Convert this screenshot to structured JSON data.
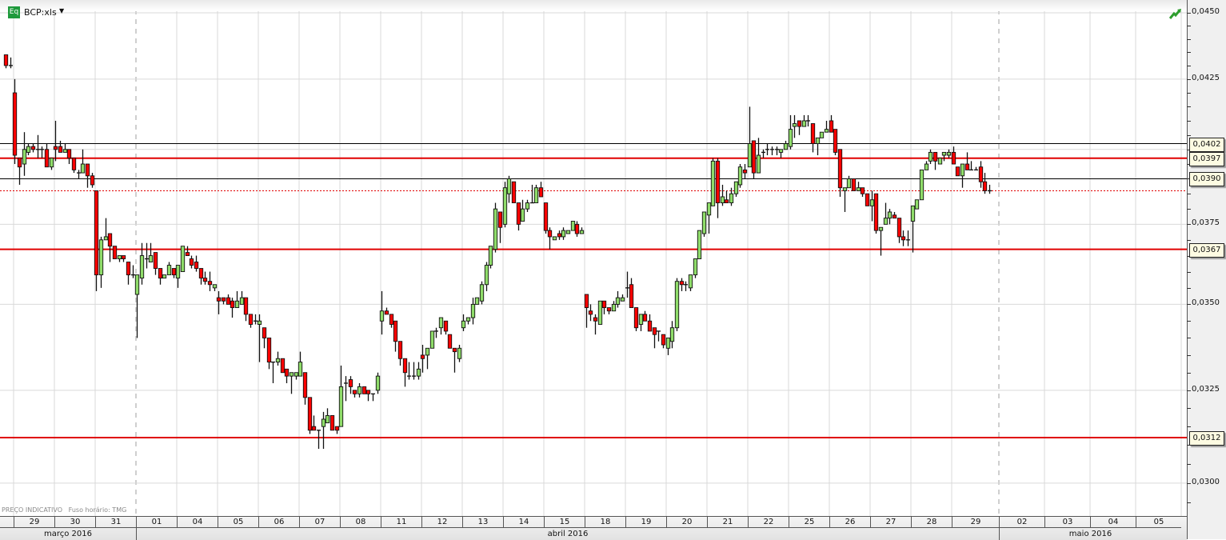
{
  "header": {
    "icon_label": "Eq",
    "symbol": "BCP:xls",
    "caret": "▼",
    "trend_icon": "trend-up-icon"
  },
  "footer": {
    "note": "PREÇO INDICATIVO   Fuso horário: TMG"
  },
  "colors": {
    "up": "#8fdc6a",
    "down": "#ff0000",
    "hline_red": "#e00000",
    "hline_black": "#000000",
    "grid": "#d9d9d9"
  },
  "chart_data": {
    "type": "candlestick",
    "title": "BCP:xls",
    "scale": "log",
    "ylim": [
      0.029,
      0.045
    ],
    "y_ticks": [
      {
        "value": 0.045,
        "label": "0,0450"
      },
      {
        "value": 0.0425,
        "label": "0,0425"
      },
      {
        "value": 0.0375,
        "label": "0,0375"
      },
      {
        "value": 0.035,
        "label": "0,0350"
      },
      {
        "value": 0.0325,
        "label": "0,0325"
      },
      {
        "value": 0.03,
        "label": "0,0300"
      }
    ],
    "grid_values": [
      0.045,
      0.0425,
      0.04,
      0.0375,
      0.035,
      0.0325,
      0.03
    ],
    "price_lines": [
      {
        "value": 0.0402,
        "label": "0,0402",
        "color": "black",
        "style": "solid"
      },
      {
        "value": 0.0397,
        "label": "0,0397",
        "color": "red",
        "style": "solid"
      },
      {
        "value": 0.039,
        "label": "0,0390",
        "color": "black",
        "style": "solid"
      },
      {
        "value": 0.0386,
        "label": "",
        "color": "red",
        "style": "dotted"
      },
      {
        "value": 0.0367,
        "label": "0,0367",
        "color": "red",
        "style": "solid"
      },
      {
        "value": 0.0312,
        "label": "0,0312",
        "color": "red",
        "style": "solid"
      }
    ],
    "days": [
      "29",
      "30",
      "31",
      "01",
      "04",
      "05",
      "06",
      "07",
      "08",
      "11",
      "12",
      "13",
      "14",
      "15",
      "18",
      "19",
      "20",
      "21",
      "22",
      "25",
      "26",
      "27",
      "28",
      "29",
      "02",
      "03",
      "04",
      "05"
    ],
    "months": [
      {
        "label": "março 2016",
        "first_day": 0,
        "last_day": 2
      },
      {
        "label": "abril 2016",
        "first_day": 3,
        "last_day": 23
      },
      {
        "label": "maio 2016",
        "first_day": 24,
        "last_day": 27
      }
    ],
    "ohlc_format": [
      "open",
      "high",
      "low",
      "close"
    ],
    "candles": [
      [
        0.0434,
        0.0434,
        0.0429,
        0.043
      ],
      [
        0.043,
        0.0433,
        0.0429,
        0.043
      ],
      [
        0.042,
        0.0425,
        0.0395,
        0.0398
      ],
      [
        0.0397,
        0.0397,
        0.0388,
        0.0394
      ],
      [
        0.0395,
        0.0406,
        0.0391,
        0.04
      ],
      [
        0.0399,
        0.0402,
        0.0398,
        0.0401
      ],
      [
        0.0401,
        0.0402,
        0.0399,
        0.04
      ],
      [
        0.04,
        0.0405,
        0.0397,
        0.04
      ],
      [
        0.04,
        0.0401,
        0.0397,
        0.04
      ],
      [
        0.04,
        0.0402,
        0.0394,
        0.0394
      ],
      [
        0.0394,
        0.0397,
        0.0393,
        0.0397
      ],
      [
        0.0401,
        0.041,
        0.0396,
        0.04
      ],
      [
        0.0401,
        0.0403,
        0.0399,
        0.0399
      ],
      [
        0.0399,
        0.0402,
        0.0399,
        0.04
      ],
      [
        0.04,
        0.04,
        0.0395,
        0.0397
      ],
      [
        0.0397,
        0.0397,
        0.0392,
        0.0393
      ],
      [
        0.0392,
        0.0393,
        0.039,
        0.0392
      ],
      [
        0.0392,
        0.04,
        0.0392,
        0.0395
      ],
      [
        0.0395,
        0.0395,
        0.0387,
        0.0391
      ],
      [
        0.0391,
        0.0392,
        0.0387,
        0.0388
      ],
      [
        0.0386,
        0.0386,
        0.0354,
        0.0359
      ],
      [
        0.0359,
        0.0371,
        0.0355,
        0.037
      ],
      [
        0.037,
        0.0377,
        0.037,
        0.0371
      ],
      [
        0.0372,
        0.0372,
        0.0363,
        0.0368
      ],
      [
        0.0368,
        0.0368,
        0.0364,
        0.0364
      ],
      [
        0.0364,
        0.0365,
        0.0363,
        0.0365
      ],
      [
        0.0365,
        0.0365,
        0.0363,
        0.0364
      ],
      [
        0.0363,
        0.0363,
        0.0356,
        0.0359
      ],
      [
        0.0359,
        0.0362,
        0.0358,
        0.0359
      ],
      [
        0.0353,
        0.0359,
        0.034,
        0.0359
      ],
      [
        0.0358,
        0.0369,
        0.0356,
        0.0365
      ],
      [
        0.0364,
        0.0369,
        0.0361,
        0.0364
      ],
      [
        0.0363,
        0.0369,
        0.0363,
        0.0365
      ],
      [
        0.0366,
        0.0366,
        0.0359,
        0.0361
      ],
      [
        0.0361,
        0.0361,
        0.0356,
        0.0358
      ],
      [
        0.0358,
        0.0359,
        0.0358,
        0.0359
      ],
      [
        0.0359,
        0.0363,
        0.0359,
        0.0362
      ],
      [
        0.0361,
        0.0361,
        0.0358,
        0.0359
      ],
      [
        0.0358,
        0.0362,
        0.0355,
        0.0362
      ],
      [
        0.036,
        0.0368,
        0.036,
        0.0368
      ],
      [
        0.0366,
        0.0368,
        0.0365,
        0.0365
      ],
      [
        0.0364,
        0.0365,
        0.0361,
        0.0362
      ],
      [
        0.0363,
        0.0365,
        0.036,
        0.0361
      ],
      [
        0.0361,
        0.0361,
        0.0356,
        0.0358
      ],
      [
        0.0358,
        0.036,
        0.0356,
        0.0357
      ],
      [
        0.0357,
        0.036,
        0.0354,
        0.0356
      ],
      [
        0.0355,
        0.0356,
        0.0354,
        0.0356
      ],
      [
        0.0352,
        0.0354,
        0.0347,
        0.0351
      ],
      [
        0.0352,
        0.0352,
        0.035,
        0.0351
      ],
      [
        0.0352,
        0.0353,
        0.035,
        0.035
      ],
      [
        0.0351,
        0.0352,
        0.0346,
        0.0349
      ],
      [
        0.0349,
        0.0354,
        0.0349,
        0.0351
      ],
      [
        0.035,
        0.0354,
        0.035,
        0.0352
      ],
      [
        0.0352,
        0.0352,
        0.0345,
        0.0347
      ],
      [
        0.0347,
        0.0347,
        0.0343,
        0.0344
      ],
      [
        0.0345,
        0.0347,
        0.0344,
        0.0345
      ],
      [
        0.0344,
        0.0347,
        0.0333,
        0.0345
      ],
      [
        0.0343,
        0.0343,
        0.0337,
        0.034
      ],
      [
        0.034,
        0.034,
        0.0331,
        0.0333
      ],
      [
        0.0333,
        0.0333,
        0.0327,
        0.0333
      ],
      [
        0.0333,
        0.0336,
        0.0332,
        0.0334
      ],
      [
        0.0334,
        0.0334,
        0.033,
        0.033
      ],
      [
        0.0331,
        0.0331,
        0.0327,
        0.0329
      ],
      [
        0.0329,
        0.033,
        0.0324,
        0.033
      ],
      [
        0.0329,
        0.033,
        0.0328,
        0.033
      ],
      [
        0.0329,
        0.0336,
        0.0329,
        0.0333
      ],
      [
        0.033,
        0.033,
        0.0321,
        0.0323
      ],
      [
        0.0323,
        0.0323,
        0.0313,
        0.0314
      ],
      [
        0.0315,
        0.0318,
        0.0314,
        0.0314
      ],
      [
        0.0314,
        0.0314,
        0.0309,
        0.0314
      ],
      [
        0.0315,
        0.0319,
        0.0309,
        0.0317
      ],
      [
        0.0316,
        0.032,
        0.0316,
        0.0318
      ],
      [
        0.0318,
        0.0318,
        0.0314,
        0.0314
      ],
      [
        0.0315,
        0.0315,
        0.0313,
        0.0314
      ],
      [
        0.0315,
        0.0332,
        0.0315,
        0.0326
      ],
      [
        0.0327,
        0.0329,
        0.0322,
        0.0327
      ],
      [
        0.0328,
        0.0329,
        0.0324,
        0.0326
      ],
      [
        0.0325,
        0.0325,
        0.0323,
        0.0324
      ],
      [
        0.0324,
        0.0327,
        0.0323,
        0.0326
      ],
      [
        0.0326,
        0.0326,
        0.0324,
        0.0324
      ],
      [
        0.0325,
        0.0325,
        0.0322,
        0.0324
      ],
      [
        0.0324,
        0.0324,
        0.0322,
        0.0324
      ],
      [
        0.0325,
        0.033,
        0.0324,
        0.0329
      ],
      [
        0.0345,
        0.0354,
        0.0341,
        0.0348
      ],
      [
        0.0348,
        0.0349,
        0.0347,
        0.0347
      ],
      [
        0.0347,
        0.0347,
        0.0343,
        0.0344
      ],
      [
        0.0345,
        0.0345,
        0.0336,
        0.0339
      ],
      [
        0.0339,
        0.0339,
        0.0332,
        0.0334
      ],
      [
        0.0334,
        0.0334,
        0.0326,
        0.033
      ],
      [
        0.0329,
        0.0333,
        0.0328,
        0.0329
      ],
      [
        0.0329,
        0.0333,
        0.0328,
        0.0329
      ],
      [
        0.0329,
        0.0333,
        0.0328,
        0.0331
      ],
      [
        0.0335,
        0.0338,
        0.033,
        0.0334
      ],
      [
        0.0335,
        0.0337,
        0.0331,
        0.0337
      ],
      [
        0.0337,
        0.0342,
        0.0337,
        0.0342
      ],
      [
        0.0342,
        0.0343,
        0.034,
        0.0342
      ],
      [
        0.0343,
        0.0346,
        0.0341,
        0.0346
      ],
      [
        0.0345,
        0.0345,
        0.0341,
        0.0342
      ],
      [
        0.0341,
        0.0341,
        0.0337,
        0.0337
      ],
      [
        0.0337,
        0.0337,
        0.033,
        0.0336
      ],
      [
        0.0334,
        0.0338,
        0.0333,
        0.0337
      ],
      [
        0.0343,
        0.0347,
        0.0342,
        0.0345
      ],
      [
        0.0345,
        0.0346,
        0.0344,
        0.0346
      ],
      [
        0.0346,
        0.0352,
        0.0344,
        0.035
      ],
      [
        0.035,
        0.0352,
        0.035,
        0.0352
      ],
      [
        0.0351,
        0.0357,
        0.035,
        0.0356
      ],
      [
        0.0356,
        0.0363,
        0.0354,
        0.0362
      ],
      [
        0.0362,
        0.0368,
        0.0361,
        0.0368
      ],
      [
        0.0367,
        0.0382,
        0.0366,
        0.038
      ],
      [
        0.0379,
        0.0379,
        0.0369,
        0.0374
      ],
      [
        0.0375,
        0.0389,
        0.0374,
        0.0387
      ],
      [
        0.0385,
        0.0391,
        0.0382,
        0.039
      ],
      [
        0.0389,
        0.0389,
        0.0382,
        0.0382
      ],
      [
        0.0382,
        0.0382,
        0.0373,
        0.0375
      ],
      [
        0.0376,
        0.0383,
        0.0376,
        0.038
      ],
      [
        0.038,
        0.0383,
        0.0379,
        0.0382
      ],
      [
        0.0382,
        0.0388,
        0.0382,
        0.0382
      ],
      [
        0.0382,
        0.0388,
        0.0382,
        0.0387
      ],
      [
        0.0387,
        0.0389,
        0.0384,
        0.0384
      ],
      [
        0.0382,
        0.0382,
        0.0372,
        0.0373
      ],
      [
        0.0373,
        0.0374,
        0.0367,
        0.0371
      ],
      [
        0.037,
        0.0371,
        0.037,
        0.0371
      ],
      [
        0.0372,
        0.0373,
        0.037,
        0.0371
      ],
      [
        0.0371,
        0.0374,
        0.037,
        0.0373
      ],
      [
        0.0372,
        0.0373,
        0.0372,
        0.0373
      ],
      [
        0.0373,
        0.0376,
        0.0373,
        0.0376
      ],
      [
        0.0375,
        0.0376,
        0.0371,
        0.0372
      ],
      [
        0.0372,
        0.0374,
        0.0372,
        0.0373
      ],
      [
        0.0353,
        0.0353,
        0.0343,
        0.0349
      ],
      [
        0.0348,
        0.035,
        0.0345,
        0.0347
      ],
      [
        0.0346,
        0.0347,
        0.0341,
        0.0345
      ],
      [
        0.0344,
        0.0351,
        0.0344,
        0.0351
      ],
      [
        0.0351,
        0.0351,
        0.0347,
        0.0349
      ],
      [
        0.0349,
        0.0349,
        0.0347,
        0.0348
      ],
      [
        0.0348,
        0.0351,
        0.0348,
        0.035
      ],
      [
        0.035,
        0.0354,
        0.0349,
        0.0352
      ],
      [
        0.0351,
        0.0353,
        0.0351,
        0.0352
      ],
      [
        0.0355,
        0.036,
        0.0352,
        0.0355
      ],
      [
        0.0356,
        0.0358,
        0.0349,
        0.0349
      ],
      [
        0.0349,
        0.0349,
        0.0342,
        0.0343
      ],
      [
        0.0344,
        0.0347,
        0.0342,
        0.0347
      ],
      [
        0.0347,
        0.0348,
        0.0345,
        0.0345
      ],
      [
        0.0345,
        0.0347,
        0.0342,
        0.0342
      ],
      [
        0.0343,
        0.0343,
        0.0337,
        0.0341
      ],
      [
        0.0342,
        0.0342,
        0.0339,
        0.0342
      ],
      [
        0.0341,
        0.0341,
        0.0337,
        0.0338
      ],
      [
        0.0337,
        0.034,
        0.0335,
        0.034
      ],
      [
        0.0339,
        0.0345,
        0.0337,
        0.0343
      ],
      [
        0.0343,
        0.0358,
        0.0342,
        0.0357
      ],
      [
        0.0357,
        0.0358,
        0.0354,
        0.0356
      ],
      [
        0.0356,
        0.0357,
        0.0354,
        0.0356
      ],
      [
        0.0355,
        0.0359,
        0.0354,
        0.0359
      ],
      [
        0.0359,
        0.0364,
        0.0358,
        0.0364
      ],
      [
        0.0364,
        0.0373,
        0.0364,
        0.0373
      ],
      [
        0.0372,
        0.0379,
        0.0371,
        0.0379
      ],
      [
        0.0378,
        0.0382,
        0.0372,
        0.0382
      ],
      [
        0.0381,
        0.0397,
        0.0381,
        0.0396
      ],
      [
        0.0396,
        0.0397,
        0.0377,
        0.0382
      ],
      [
        0.0382,
        0.0388,
        0.0381,
        0.0384
      ],
      [
        0.0383,
        0.0386,
        0.0382,
        0.0382
      ],
      [
        0.0382,
        0.0387,
        0.0381,
        0.0385
      ],
      [
        0.0385,
        0.0389,
        0.0384,
        0.0389
      ],
      [
        0.0388,
        0.0395,
        0.0387,
        0.0394
      ],
      [
        0.0393,
        0.0395,
        0.039,
        0.0392
      ],
      [
        0.0394,
        0.0415,
        0.0394,
        0.0402
      ],
      [
        0.0403,
        0.0403,
        0.039,
        0.0392
      ],
      [
        0.0392,
        0.0404,
        0.0392,
        0.0398
      ],
      [
        0.0399,
        0.04,
        0.0397,
        0.0399
      ],
      [
        0.04,
        0.0402,
        0.0398,
        0.04
      ],
      [
        0.04,
        0.0401,
        0.0398,
        0.04
      ],
      [
        0.04,
        0.0401,
        0.0398,
        0.04
      ],
      [
        0.0399,
        0.04,
        0.0397,
        0.04
      ],
      [
        0.04,
        0.0403,
        0.04,
        0.0402
      ],
      [
        0.0401,
        0.0412,
        0.04,
        0.0407
      ],
      [
        0.0408,
        0.0412,
        0.0404,
        0.0409
      ],
      [
        0.041,
        0.041,
        0.0405,
        0.0408
      ],
      [
        0.0408,
        0.0412,
        0.0408,
        0.041
      ],
      [
        0.041,
        0.0412,
        0.0408,
        0.041
      ],
      [
        0.0409,
        0.0409,
        0.0399,
        0.0402
      ],
      [
        0.0402,
        0.0404,
        0.0398,
        0.0404
      ],
      [
        0.0404,
        0.0406,
        0.0404,
        0.0406
      ],
      [
        0.0406,
        0.041,
        0.0406,
        0.0407
      ],
      [
        0.041,
        0.0412,
        0.0406,
        0.0406
      ],
      [
        0.0407,
        0.0407,
        0.0398,
        0.0399
      ],
      [
        0.04,
        0.04,
        0.0384,
        0.0387
      ],
      [
        0.0386,
        0.0387,
        0.0379,
        0.0387
      ],
      [
        0.0387,
        0.0391,
        0.0387,
        0.039
      ],
      [
        0.039,
        0.039,
        0.0386,
        0.0386
      ],
      [
        0.0386,
        0.0389,
        0.0386,
        0.0387
      ],
      [
        0.0387,
        0.0387,
        0.0384,
        0.0385
      ],
      [
        0.0385,
        0.0385,
        0.0381,
        0.0381
      ],
      [
        0.0381,
        0.0386,
        0.0376,
        0.0383
      ],
      [
        0.0385,
        0.0385,
        0.0372,
        0.0373
      ],
      [
        0.0373,
        0.0374,
        0.0365,
        0.0374
      ],
      [
        0.0375,
        0.0382,
        0.0375,
        0.0377
      ],
      [
        0.0377,
        0.038,
        0.0375,
        0.0379
      ],
      [
        0.0378,
        0.0379,
        0.0377,
        0.0377
      ],
      [
        0.0377,
        0.0377,
        0.0369,
        0.0371
      ],
      [
        0.0371,
        0.0373,
        0.0368,
        0.037
      ],
      [
        0.037,
        0.0373,
        0.0368,
        0.037
      ],
      [
        0.0376,
        0.0381,
        0.0366,
        0.0381
      ],
      [
        0.038,
        0.0383,
        0.038,
        0.0383
      ],
      [
        0.0383,
        0.0393,
        0.0383,
        0.0393
      ],
      [
        0.0393,
        0.0396,
        0.0393,
        0.0395
      ],
      [
        0.0396,
        0.04,
        0.0395,
        0.0399
      ],
      [
        0.0399,
        0.0399,
        0.0393,
        0.0396
      ],
      [
        0.0395,
        0.0397,
        0.0395,
        0.0397
      ],
      [
        0.0398,
        0.0399,
        0.0396,
        0.0399
      ],
      [
        0.0398,
        0.04,
        0.0397,
        0.0399
      ],
      [
        0.0399,
        0.0401,
        0.0395,
        0.0395
      ],
      [
        0.0394,
        0.0394,
        0.0391,
        0.0391
      ],
      [
        0.0391,
        0.0395,
        0.0387,
        0.0395
      ],
      [
        0.0395,
        0.0399,
        0.0393,
        0.0393
      ],
      [
        0.0393,
        0.0396,
        0.0393,
        0.0393
      ],
      [
        0.0393,
        0.0394,
        0.0393,
        0.0393
      ],
      [
        0.0394,
        0.0396,
        0.0387,
        0.0389
      ],
      [
        0.0389,
        0.0392,
        0.0385,
        0.0386
      ],
      [
        0.0386,
        0.0388,
        0.0385,
        0.0386
      ]
    ]
  }
}
